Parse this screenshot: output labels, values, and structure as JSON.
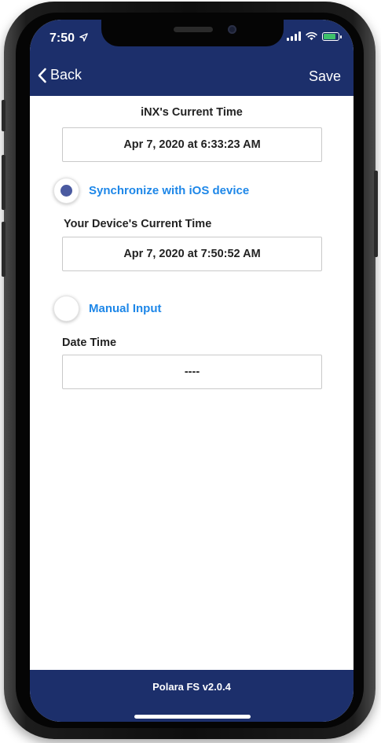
{
  "status_bar": {
    "time": "7:50",
    "location_icon": "location-arrow-icon",
    "signal_icon": "cellular-signal-icon",
    "wifi_icon": "wifi-icon",
    "battery_icon": "battery-charging-icon"
  },
  "nav": {
    "back_label": "Back",
    "back_icon": "chevron-left-icon",
    "save_label": "Save"
  },
  "inx_time": {
    "label": "iNX's Current Time",
    "value": "Apr 7, 2020 at 6:33:23 AM"
  },
  "sync_option": {
    "label": "Synchronize with iOS device",
    "selected": true
  },
  "device_time": {
    "label": "Your Device's Current Time",
    "value": "Apr 7, 2020 at 7:50:52 AM"
  },
  "manual_option": {
    "label": "Manual Input",
    "selected": false
  },
  "date_time": {
    "label": "Date Time",
    "value": "----"
  },
  "footer": {
    "version": "Polara FS v2.0.4"
  },
  "colors": {
    "header": "#1c2f6b",
    "accent": "#1e87e8",
    "radio_dot": "#4a5aa0"
  }
}
